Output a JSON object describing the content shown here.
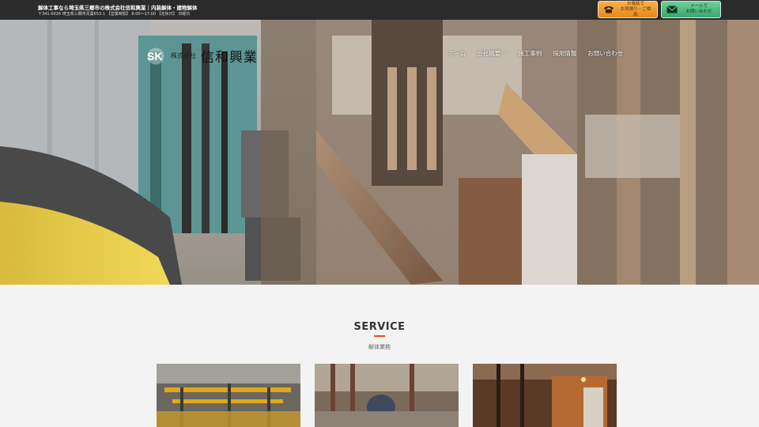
{
  "topbar": {
    "headline": "解体工事なら埼玉県三郷市の株式会社信和興業｜内装解体・建物解体",
    "address": "〒341-0026 埼玉県三郷市青葉653-1 【営業時間】 8:00〜17:00 【定休日】 日曜日"
  },
  "cta": {
    "phone": {
      "line1": "お電話で",
      "line2": "お見積り・ご相談",
      "icon": "phone-icon"
    },
    "mail": {
      "line1": "メールで",
      "line2": "お問い合わせ",
      "icon": "mail-icon"
    }
  },
  "logo": {
    "mark": "SK",
    "prefix": "株式会社",
    "name": "信和興業"
  },
  "nav": {
    "items": [
      {
        "label": "ホーム"
      },
      {
        "label": "会社概要",
        "has_dropdown": true
      },
      {
        "label": "施工事例"
      },
      {
        "label": "採用情報"
      },
      {
        "label": "お問い合わせ"
      }
    ],
    "chevron": "﹀"
  },
  "service": {
    "title": "SERVICE",
    "subtitle": "解体業務"
  },
  "colors": {
    "topbar": "#2b2b2b",
    "accent": "#d9531e",
    "phone_cta": "#e58a1c",
    "mail_cta": "#3aa86c"
  }
}
